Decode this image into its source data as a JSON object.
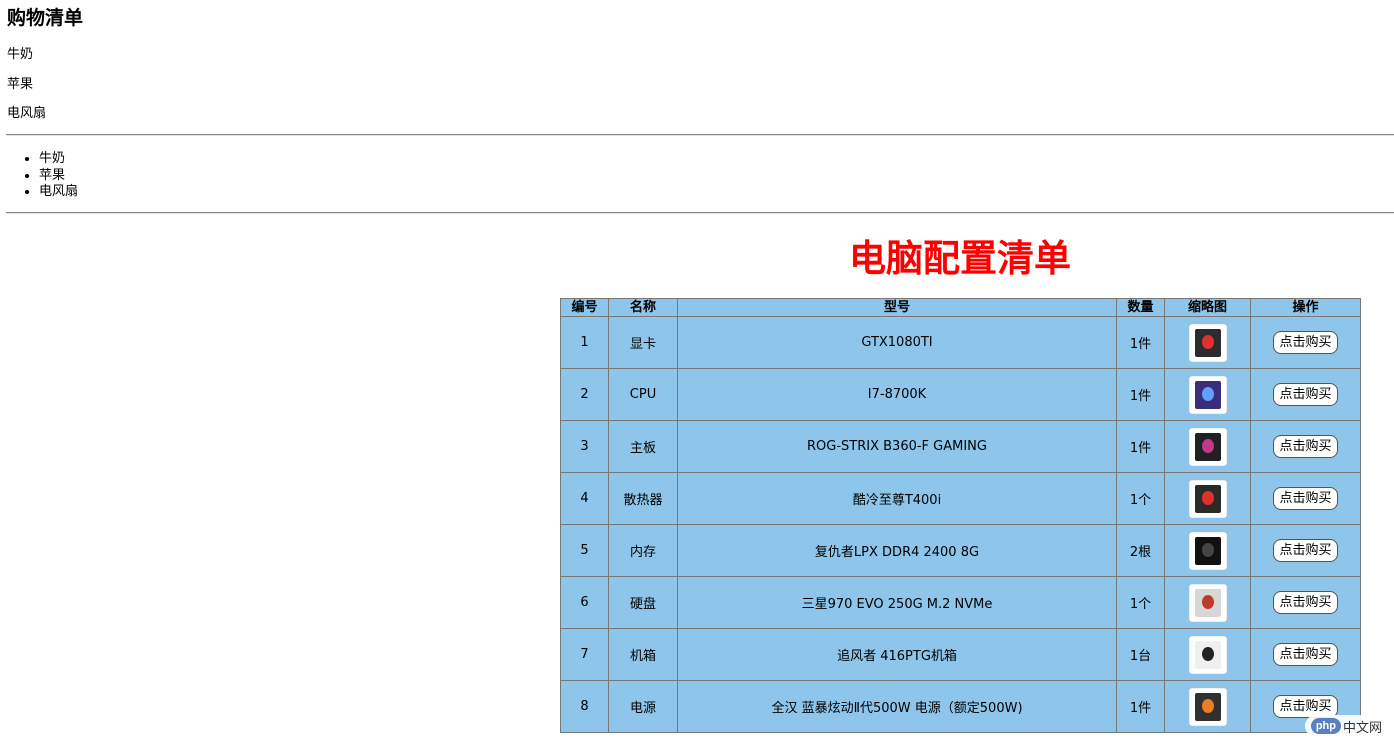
{
  "shopping": {
    "title": "购物清单",
    "paragraphs": [
      "牛奶",
      "苹果",
      "电风扇"
    ],
    "list": [
      "牛奶",
      "苹果",
      "电风扇"
    ]
  },
  "config": {
    "title": "电脑配置清单",
    "title_color": "#ff0000",
    "table_bg": "#8dc6ea",
    "headers": [
      "编号",
      "名称",
      "型号",
      "数量",
      "缩略图",
      "操作"
    ],
    "rows": [
      {
        "no": "1",
        "name": "显卡",
        "model": "GTX1080TI",
        "qty": "1件",
        "thumb": "graphics-card-image",
        "action": "点击购买"
      },
      {
        "no": "2",
        "name": "CPU",
        "model": "I7-8700K",
        "qty": "1件",
        "thumb": "cpu-box-image",
        "action": "点击购买"
      },
      {
        "no": "3",
        "name": "主板",
        "model": "ROG-STRIX B360-F GAMING",
        "qty": "1件",
        "thumb": "motherboard-image",
        "action": "点击购买"
      },
      {
        "no": "4",
        "name": "散热器",
        "model": "酷冷至尊T400i",
        "qty": "1个",
        "thumb": "cpu-cooler-image",
        "action": "点击购买"
      },
      {
        "no": "5",
        "name": "内存",
        "model": "复仇者LPX DDR4 2400 8G",
        "qty": "2根",
        "thumb": "ram-stick-image",
        "action": "点击购买"
      },
      {
        "no": "6",
        "name": "硬盘",
        "model": "三星970 EVO 250G M.2 NVMe",
        "qty": "1个",
        "thumb": "ssd-image",
        "action": "点击购买"
      },
      {
        "no": "7",
        "name": "机箱",
        "model": "追风者 416PTG机箱",
        "qty": "1台",
        "thumb": "pc-case-image",
        "action": "点击购买"
      },
      {
        "no": "8",
        "name": "电源",
        "model": "全汉 蓝暴炫动Ⅱ代500W 电源（额定500W)",
        "qty": "1件",
        "thumb": "power-supply-image",
        "action": "点击购买"
      }
    ]
  },
  "watermark": {
    "logo": "php",
    "text": "中文网"
  }
}
